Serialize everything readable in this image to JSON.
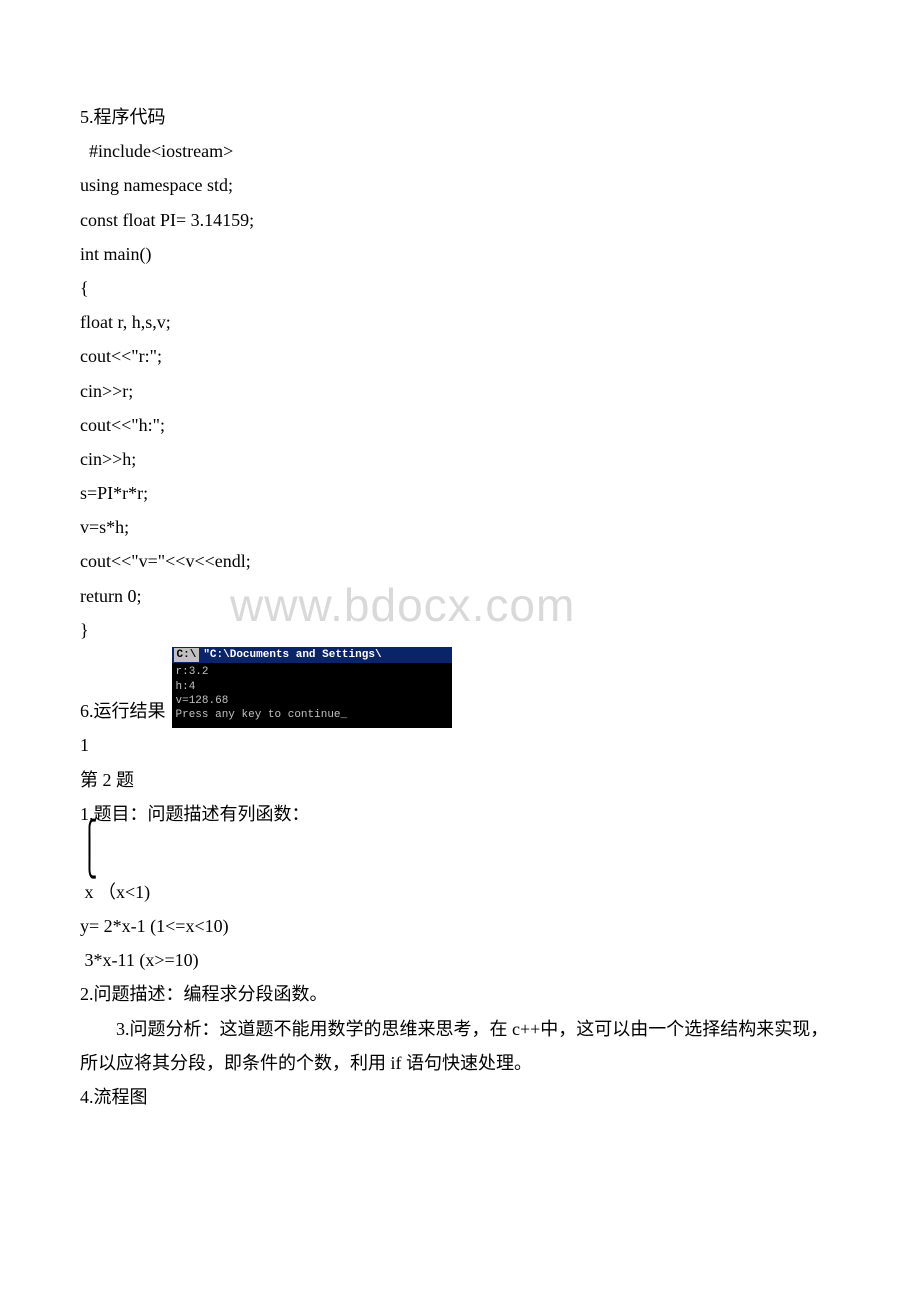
{
  "section5": {
    "heading": "5.程序代码",
    "code": [
      "  #include<iostream>",
      "using namespace std;",
      "const float PI= 3.14159;",
      "int main()",
      "{",
      " float r, h,s,v;",
      " cout<<\"r:\";",
      " cin>>r;",
      " cout<<\"h:\";",
      " cin>>h;",
      " s=PI*r*r;",
      " v=s*h;",
      " cout<<\"v=\"<<v<<endl;",
      " return 0;",
      "}"
    ]
  },
  "section6": {
    "label": "6.运行结果",
    "terminal": {
      "title_icon": "C:\\",
      "title_text": "\"C:\\Documents and Settings\\",
      "lines": [
        "r:3.2",
        "h:4",
        "v=128.68",
        "Press any key to continue_"
      ]
    },
    "after": " 1"
  },
  "question2": {
    "heading": "第 2 题",
    "item1": "1.题目：问题描述有列函数：",
    "brace_glyph": "⎧\n⎩",
    "piecewise": [
      " x （x<1)",
      "y= 2*x-1 (1<=x<10)",
      " 3*x-11 (x>=10)"
    ],
    "item2": "2.问题描述：编程求分段函数。",
    "item3": "3.问题分析：这道题不能用数学的思维来思考，在 c++中，这可以由一个选择结构来实现，所以应将其分段，即条件的个数，利用 if 语句快速处理。",
    "item4": "4.流程图"
  },
  "watermark": "www.bdocx.com"
}
